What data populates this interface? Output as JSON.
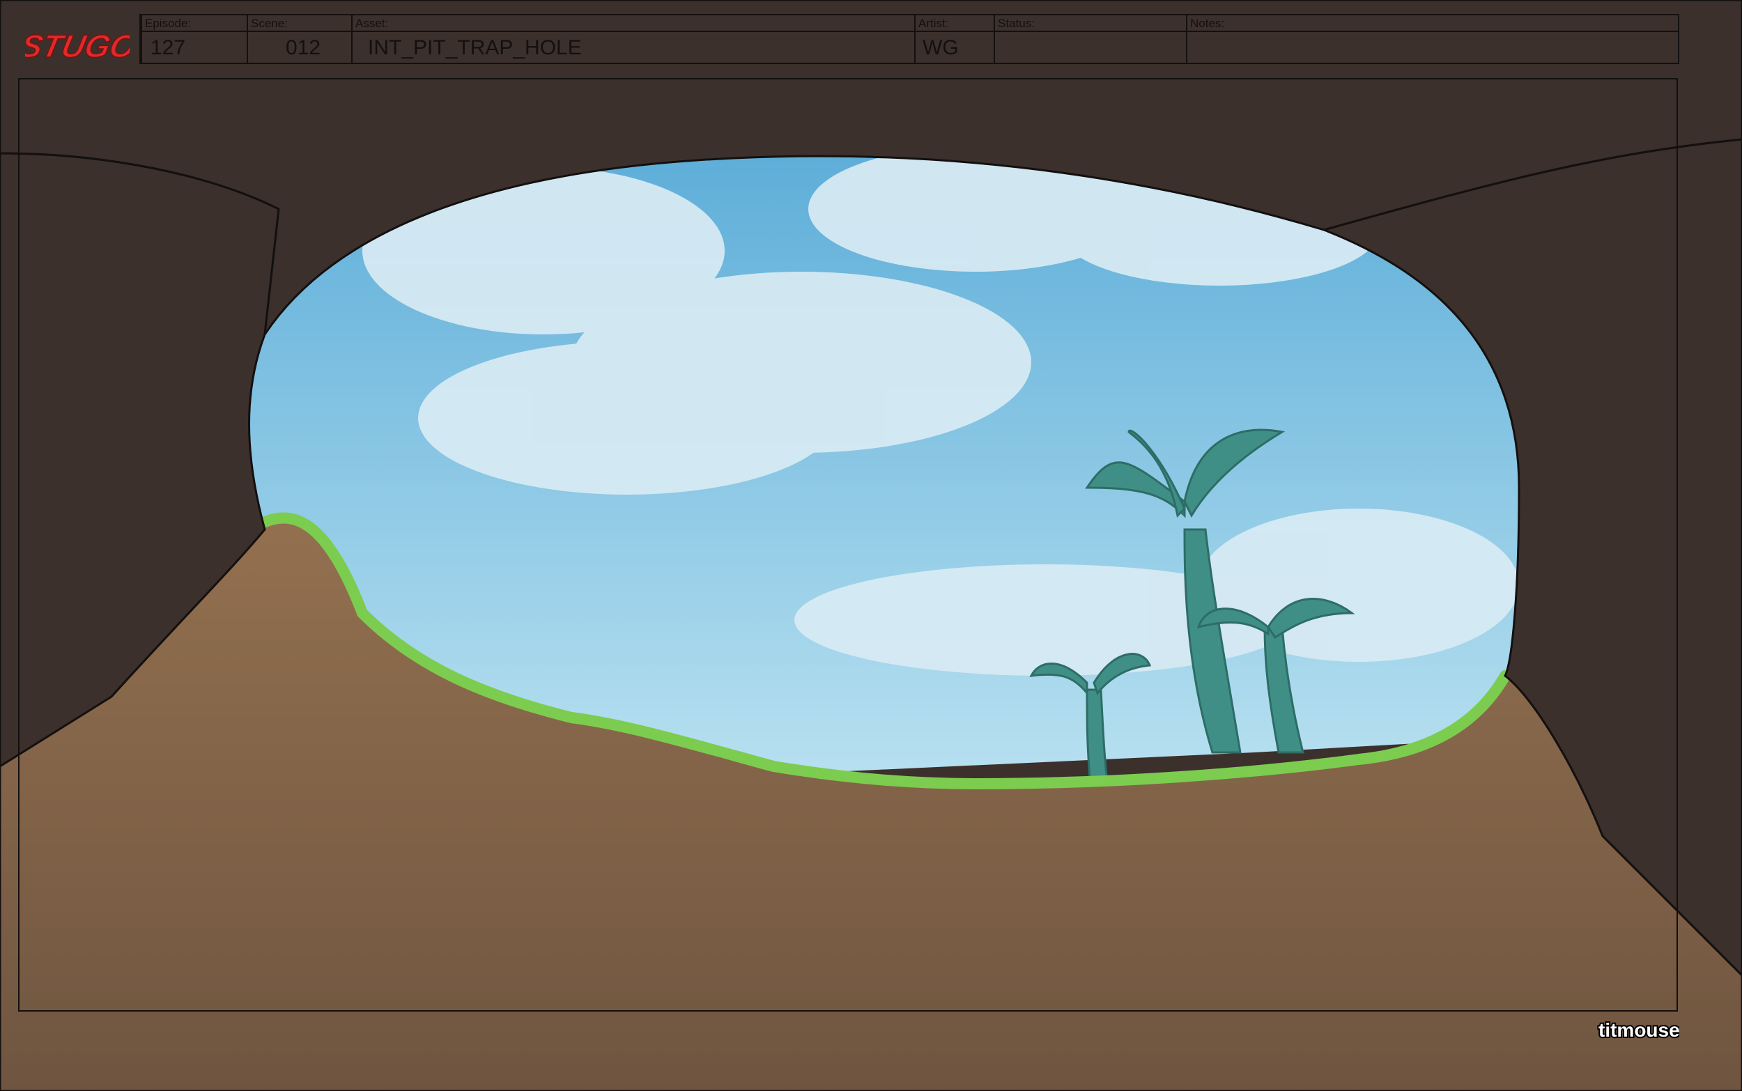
{
  "slate": {
    "episode_label": "Episode:",
    "episode_value": "127",
    "scene_label": "Scene:",
    "scene_value": "012",
    "asset_label": "Asset:",
    "asset_value": "INT_PIT_TRAP_HOLE",
    "artist_label": "Artist:",
    "artist_value": "WG",
    "status_label": "Status:",
    "status_value": "",
    "notes_label": "Notes:",
    "notes_value": ""
  },
  "logo_text": "STUGO",
  "studio_text": "titmouse",
  "colors": {
    "cave_dark": "#3b302b",
    "dirt": "#8a6a4f",
    "sky": "#6db6de",
    "grass": "#7ccc4f",
    "palm": "#3f8f86",
    "logo_red": "#e02a2a"
  }
}
